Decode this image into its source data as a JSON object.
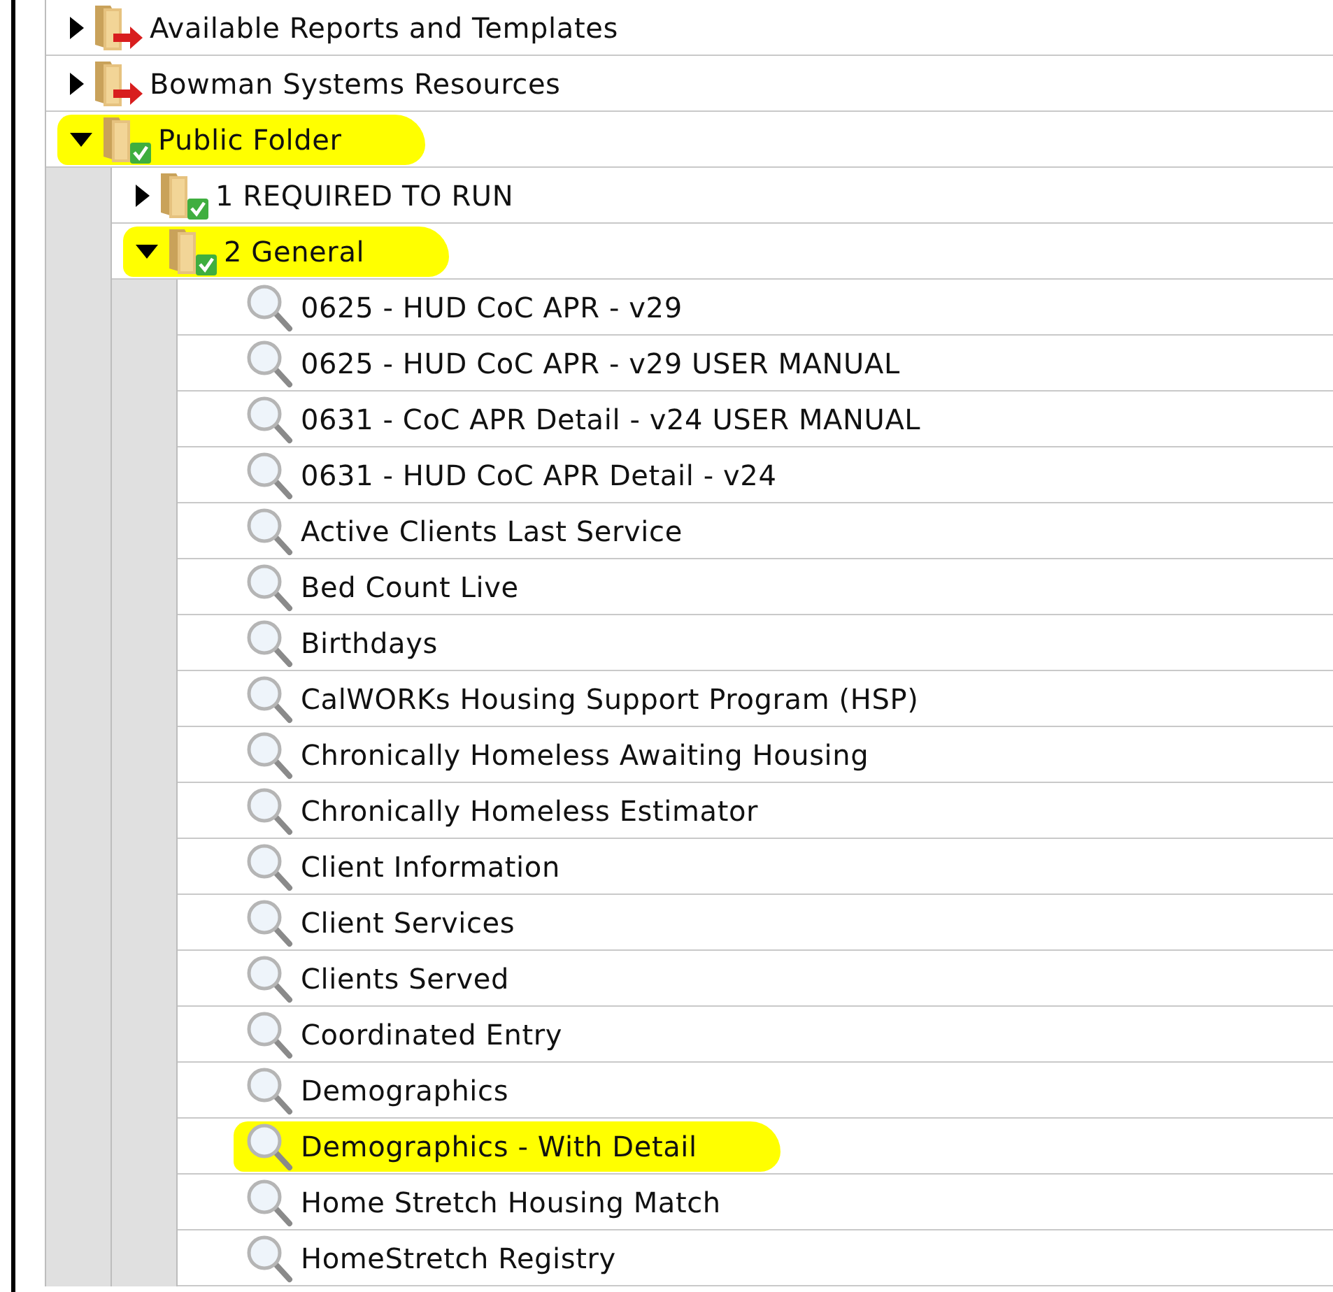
{
  "tree": [
    {
      "kind": "folder",
      "label": "Available Reports and Templates",
      "shared": true,
      "checked": false,
      "expanded": false,
      "highlighted": false
    },
    {
      "kind": "folder",
      "label": "Bowman Systems Resources",
      "shared": true,
      "checked": false,
      "expanded": false,
      "highlighted": false
    },
    {
      "kind": "folder",
      "label": "Public Folder",
      "shared": false,
      "checked": true,
      "expanded": true,
      "highlighted": true,
      "children": [
        {
          "kind": "folder",
          "label": "1 REQUIRED TO RUN",
          "shared": false,
          "checked": true,
          "expanded": false,
          "highlighted": false
        },
        {
          "kind": "folder",
          "label": "2 General",
          "shared": false,
          "checked": true,
          "expanded": true,
          "highlighted": true,
          "children": [
            {
              "kind": "report",
              "label": "0625 - HUD CoC APR - v29",
              "highlighted": false
            },
            {
              "kind": "report",
              "label": "0625 - HUD CoC APR - v29 USER MANUAL",
              "highlighted": false
            },
            {
              "kind": "report",
              "label": "0631 - CoC APR Detail - v24 USER MANUAL",
              "highlighted": false
            },
            {
              "kind": "report",
              "label": "0631 - HUD CoC APR Detail - v24",
              "highlighted": false
            },
            {
              "kind": "report",
              "label": "Active Clients Last Service",
              "highlighted": false
            },
            {
              "kind": "report",
              "label": "Bed Count Live",
              "highlighted": false
            },
            {
              "kind": "report",
              "label": "Birthdays",
              "highlighted": false
            },
            {
              "kind": "report",
              "label": "CalWORKs Housing Support Program (HSP)",
              "highlighted": false
            },
            {
              "kind": "report",
              "label": "Chronically Homeless Awaiting Housing",
              "highlighted": false
            },
            {
              "kind": "report",
              "label": "Chronically Homeless Estimator",
              "highlighted": false
            },
            {
              "kind": "report",
              "label": "Client Information",
              "highlighted": false
            },
            {
              "kind": "report",
              "label": "Client Services",
              "highlighted": false
            },
            {
              "kind": "report",
              "label": "Clients Served",
              "highlighted": false
            },
            {
              "kind": "report",
              "label": "Coordinated Entry",
              "highlighted": false
            },
            {
              "kind": "report",
              "label": "Demographics",
              "highlighted": false
            },
            {
              "kind": "report",
              "label": "Demographics - With Detail",
              "highlighted": true
            },
            {
              "kind": "report",
              "label": "Home Stretch Housing Match",
              "highlighted": false
            },
            {
              "kind": "report",
              "label": "HomeStretch Registry",
              "highlighted": false
            }
          ]
        }
      ]
    }
  ]
}
